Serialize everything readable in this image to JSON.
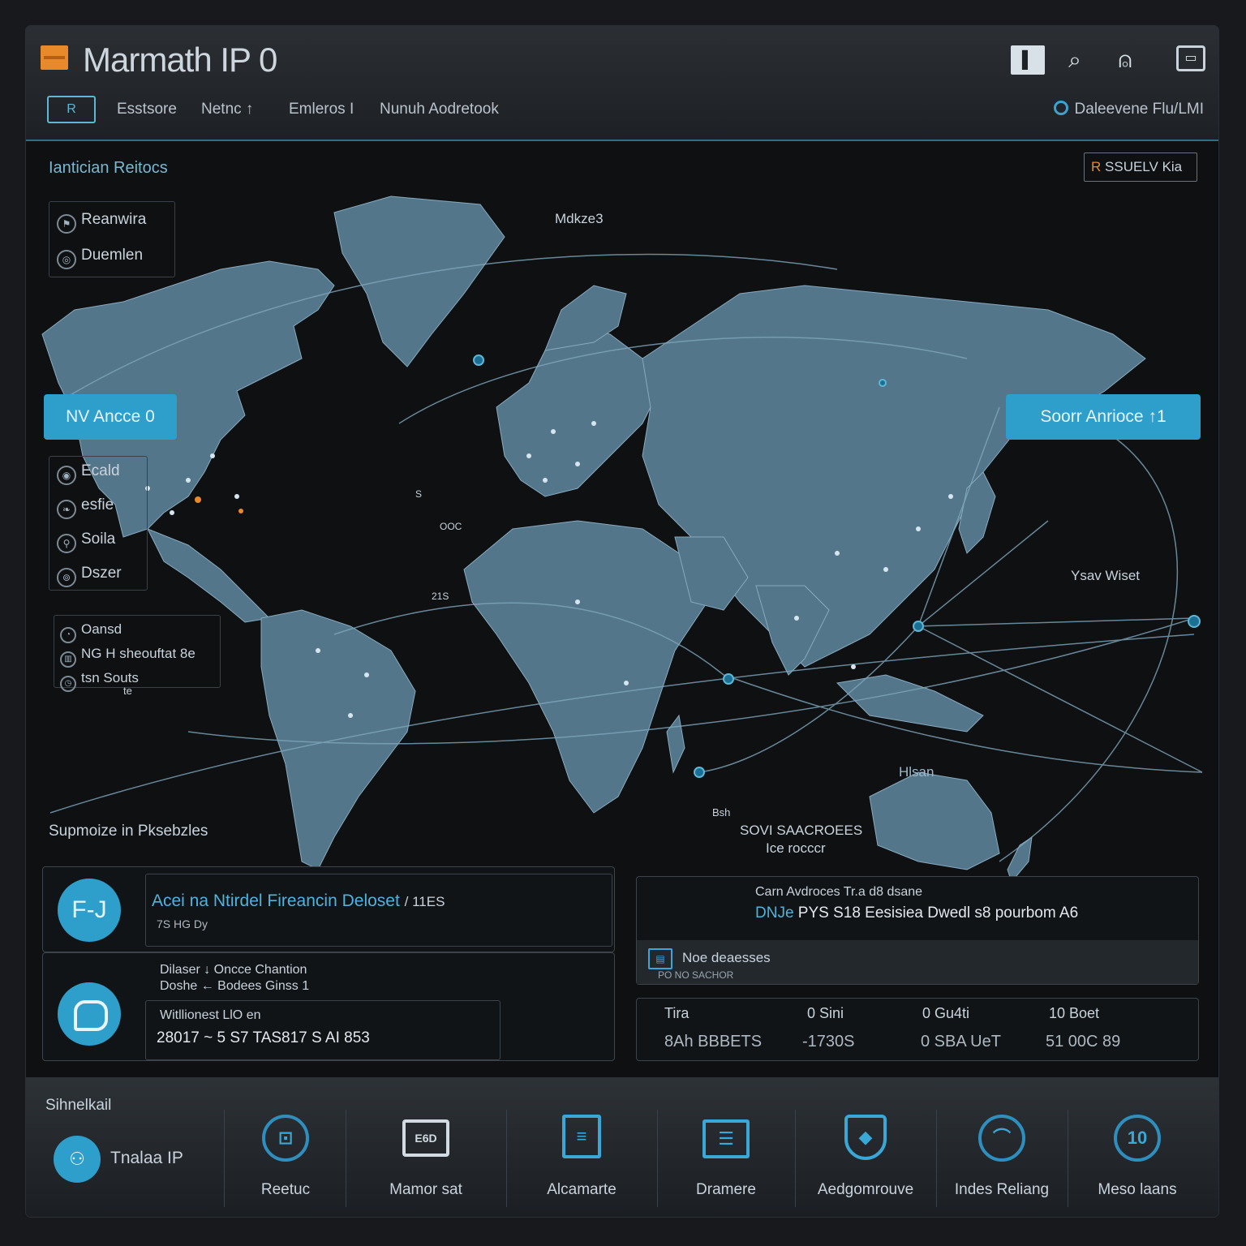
{
  "window": {
    "title": "Marmath IP 0",
    "toolbar_icons": [
      "sidebar-toggle-icon",
      "search-icon",
      "user-icon",
      "window-icon"
    ]
  },
  "nav": {
    "badge": "R",
    "items": [
      "Esstsore",
      "Netnc ↑",
      "Emleros I",
      "Nunuh Aodretook"
    ],
    "account_label": "Daleevene Flu/LMI"
  },
  "map_section": {
    "title": "Iantician Reitocs",
    "filter_prefix": "R",
    "filter_label": "SSUELV Kia",
    "top_legend": [
      {
        "icon": "flag-icon",
        "label": "Reanwira"
      },
      {
        "icon": "globe-icon",
        "label": "Duemlen"
      }
    ],
    "left_button": "NV Ancce 0",
    "right_button": "Soorr Anrioce ↑1",
    "mid_legend": [
      {
        "icon": "eye-icon",
        "label": "Ecald"
      },
      {
        "icon": "leaf-icon",
        "label": "esfie"
      },
      {
        "icon": "pin-icon",
        "label": "Soila"
      },
      {
        "icon": "target-icon",
        "label": "Dszer"
      }
    ],
    "lower_legend": [
      {
        "icon": "bell-icon",
        "label": "Oansd"
      },
      {
        "icon": "chart-icon",
        "label": "NG H sheouftat 8e"
      },
      {
        "icon": "clock-icon",
        "label": "tsn Souts"
      }
    ],
    "lower_legend_suffix": "te",
    "labels": {
      "top": "Mdkze3",
      "right": "Ysav Wiset",
      "bottom_title": "SOVI SAACROEES",
      "bottom_sub": "Ice rocccr",
      "bottom_small": "Bsh",
      "australia": "Hlsan",
      "bottom_left": "Supmoize in Pksebzles",
      "atlantic": "S",
      "africa_w": "OOC",
      "africa_s": "21S"
    }
  },
  "panel_left_top": {
    "icon": "ticket-icon",
    "icon_text": "F-J",
    "title": "Acei na Ntirdel Fireancin Deloset",
    "title_suffix": "/ 11ES",
    "subtitle": "7S HG Dy"
  },
  "panel_left_bottom": {
    "icon": "chat-icon",
    "line1": "Dilaser ↓   Oncce Chantion",
    "line2": "Doshe ← Bodees Ginss 1",
    "inner_label": "Witllionest LlO en",
    "inner_value": "28017 ~ 5 S7 TAS817 S AI 853"
  },
  "panel_right": {
    "line1": "Carn Avdroces Tr.a d8 dsane",
    "line2_prefix": "DNJe",
    "line2": "PYS  S18  Eesisiea  Dwedl s8 pourbom A6",
    "strip_label": "Noe deaesses",
    "strip_sub": "PO NO SACHOR",
    "table_headers": [
      "Tira",
      "0 Sini",
      "0 Gu4ti",
      "10 Boet"
    ],
    "table_values": [
      "8Ah BBBETS",
      "-1730S",
      "0 SBA UeT",
      "51 00C 89"
    ]
  },
  "bottom_bar": {
    "title": "Sihnelkail",
    "first": {
      "icon": "chart-icon",
      "label": "Tnalaa IP"
    },
    "tools": [
      {
        "icon": "clipboard-icon",
        "label": "Reetuc"
      },
      {
        "icon": "monitor-icon",
        "label": "Mamor sat"
      },
      {
        "icon": "document-icon",
        "label": "Alcamarte"
      },
      {
        "icon": "window-icon",
        "label": "Dramere"
      },
      {
        "icon": "shield-icon",
        "label": "Aedgomrouve"
      },
      {
        "icon": "gauge-icon",
        "label": "Indes Reliang"
      },
      {
        "icon": "gauge-icon",
        "label": "Meso laans"
      }
    ],
    "tool_glyphs": [
      "⊡",
      "E6D",
      "≡",
      "☰",
      "◆",
      "⌒",
      "10"
    ]
  },
  "colors": {
    "accent": "#2e9fcb",
    "accent_orange": "#e88a2a",
    "land": "#5a7d92",
    "background": "#0e1012"
  }
}
